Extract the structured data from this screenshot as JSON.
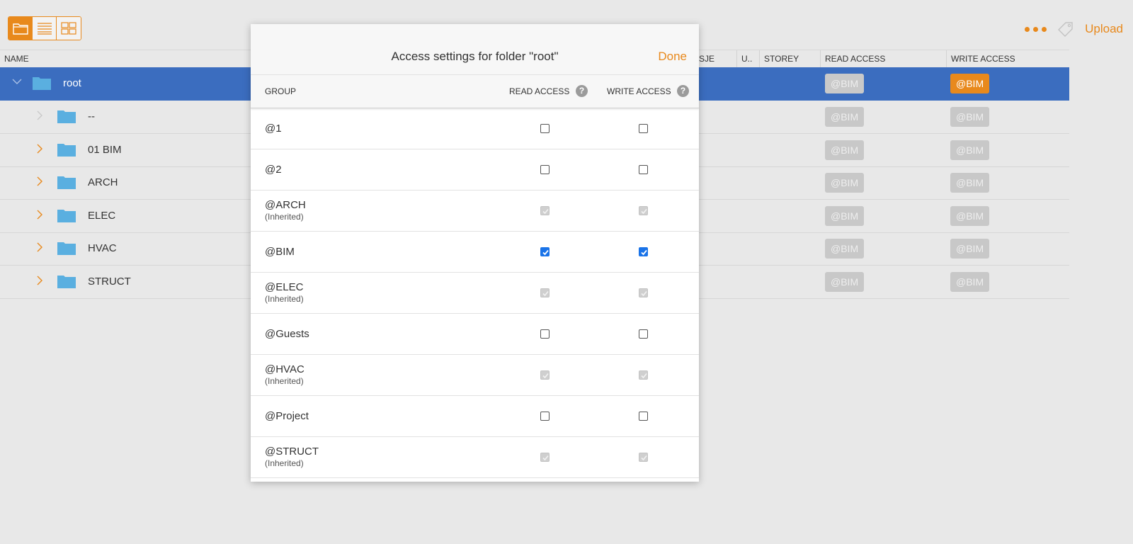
{
  "toolbar": {
    "view_buttons": [
      "folder-view",
      "list-view",
      "grid-view"
    ],
    "upload_label": "Upload"
  },
  "columns": {
    "name": "NAME",
    "partial": "SJE",
    "u": "U..",
    "storey": "STOREY",
    "read": "READ ACCESS",
    "write": "WRITE ACCESS"
  },
  "rows": [
    {
      "name": "root",
      "read": "@BIM",
      "write": "@BIM"
    },
    {
      "name": "--",
      "read": "@BIM",
      "write": "@BIM"
    },
    {
      "name": "01 BIM",
      "read": "@BIM",
      "write": "@BIM"
    },
    {
      "name": "ARCH",
      "read": "@BIM",
      "write": "@BIM"
    },
    {
      "name": "ELEC",
      "read": "@BIM",
      "write": "@BIM"
    },
    {
      "name": "HVAC",
      "read": "@BIM",
      "write": "@BIM"
    },
    {
      "name": "STRUCT",
      "read": "@BIM",
      "write": "@BIM"
    }
  ],
  "modal": {
    "title": "Access settings for folder \"root\"",
    "done_label": "Done",
    "col_group": "GROUP",
    "col_read": "READ ACCESS",
    "col_write": "WRITE ACCESS",
    "help_glyph": "?",
    "groups": [
      {
        "name": "@1",
        "inherited": "",
        "read": "unchecked",
        "write": "unchecked"
      },
      {
        "name": "@2",
        "inherited": "",
        "read": "unchecked",
        "write": "unchecked"
      },
      {
        "name": "@ARCH",
        "inherited": "(Inherited)",
        "read": "inherited",
        "write": "inherited"
      },
      {
        "name": "@BIM",
        "inherited": "",
        "read": "checked",
        "write": "checked"
      },
      {
        "name": "@ELEC",
        "inherited": "(Inherited)",
        "read": "inherited",
        "write": "inherited"
      },
      {
        "name": "@Guests",
        "inherited": "",
        "read": "unchecked",
        "write": "unchecked"
      },
      {
        "name": "@HVAC",
        "inherited": "(Inherited)",
        "read": "inherited",
        "write": "inherited"
      },
      {
        "name": "@Project",
        "inherited": "",
        "read": "unchecked",
        "write": "unchecked"
      },
      {
        "name": "@STRUCT",
        "inherited": "(Inherited)",
        "read": "inherited",
        "write": "inherited"
      }
    ]
  },
  "colors": {
    "accent": "#e8891c",
    "selection": "#3b6dbf",
    "checkbox_checked": "#1a73e8",
    "folder": "#5aafe0"
  }
}
